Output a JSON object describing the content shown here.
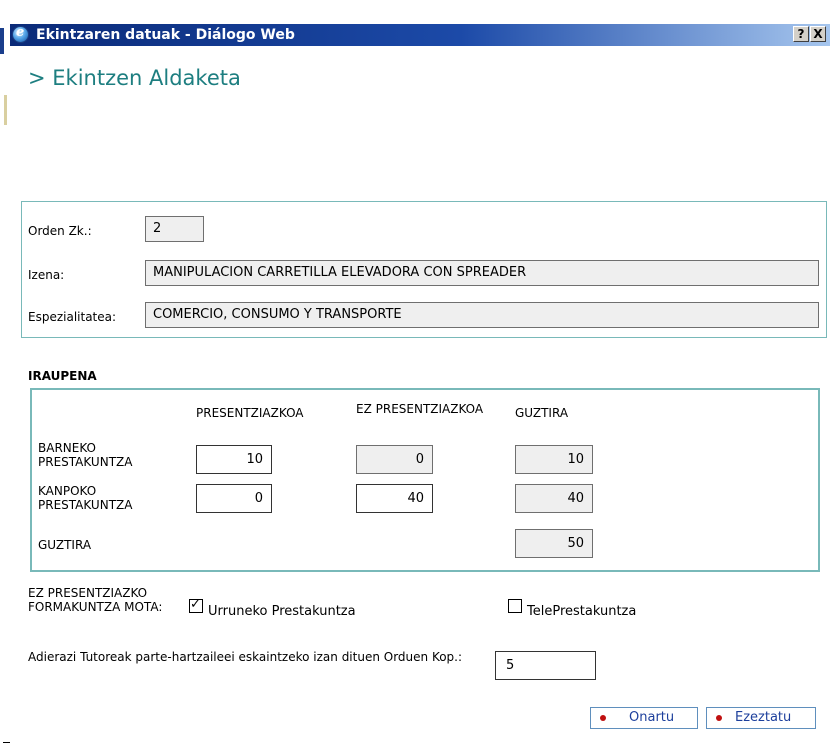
{
  "window": {
    "title": "Ekintzaren datuak - Diálogo Web",
    "help_label": "?",
    "close_label": "X"
  },
  "page": {
    "heading": "> Ekintzen Aldaketa"
  },
  "general": {
    "order_label": "Orden Zk.:",
    "order_value": "2",
    "name_label": "Izena:",
    "name_value": "MANIPULACION CARRETILLA ELEVADORA CON SPREADER",
    "specialty_label": "Espezialitatea:",
    "specialty_value": "COMERCIO, CONSUMO Y TRANSPORTE"
  },
  "duration": {
    "section_title": "IRAUPENA",
    "columns": [
      "PRESENTZIAZKOA",
      "EZ PRESENTZIAZKOA",
      "GUZTIRA"
    ],
    "rows": [
      {
        "label": "BARNEKO PRESTAKUNTZA",
        "presential": "10",
        "non_presential": "0",
        "total": "10"
      },
      {
        "label": "KANPOKO PRESTAKUNTZA",
        "presential": "0",
        "non_presential": "40",
        "total": "40"
      }
    ],
    "total_row": {
      "label": "GUZTIRA",
      "total": "50"
    }
  },
  "training_type": {
    "label": "EZ PRESENTZIAZKO FORMAKUNTZA MOTA:",
    "options": [
      {
        "label": "Urruneko Prestakuntza",
        "checked": true
      },
      {
        "label": "TelePrestakuntza",
        "checked": false
      }
    ]
  },
  "tutor_hours": {
    "label": "Adierazi Tutoreak parte-hartzaileei eskaintzeko izan dituen Orduen Kop.:",
    "value": "5"
  },
  "actions": {
    "accept_label": "Onartu",
    "cancel_label": "Ezeztatu"
  },
  "colors": {
    "heading": "#1d7e80",
    "panel_border": "#79b9b9",
    "titlebar": "#0a2a78",
    "button_text": "#1d3f9c",
    "button_dot": "#c01010"
  }
}
